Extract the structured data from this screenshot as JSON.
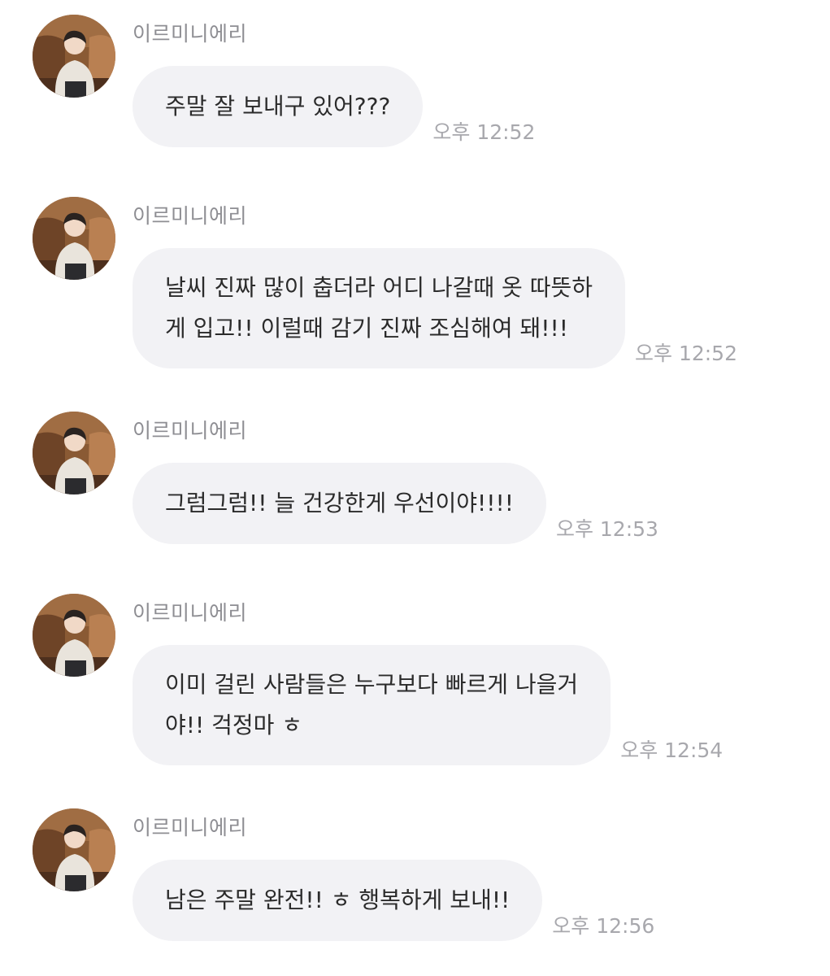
{
  "messages": [
    {
      "sender": "이르미니에리",
      "lines": [
        "주말 잘 보내구 있어???"
      ],
      "time": "오후 12:52"
    },
    {
      "sender": "이르미니에리",
      "lines": [
        "날씨 진짜 많이 춥더라 어디 나갈때 옷 따뜻하",
        "게 입고!! 이럴때 감기 진짜 조심해여 돼!!!"
      ],
      "time": "오후 12:52"
    },
    {
      "sender": "이르미니에리",
      "lines": [
        "그럼그럼!! 늘 건강한게 우선이야!!!!"
      ],
      "time": "오후 12:53"
    },
    {
      "sender": "이르미니에리",
      "lines": [
        "이미 걸린 사람들은 누구보다 빠르게 나을거",
        "야!! 걱정마 ㅎ"
      ],
      "time": "오후 12:54"
    },
    {
      "sender": "이르미니에리",
      "lines": [
        "남은 주말 완전!! ㅎ 행복하게 보내!!"
      ],
      "time": "오후 12:56"
    }
  ],
  "colors": {
    "bubble": "#f2f2f5",
    "sender": "#8e8e93",
    "time": "#a8a8ad",
    "text": "#2b2b2b"
  },
  "icons": {
    "avatar": "profile-photo-icon"
  }
}
